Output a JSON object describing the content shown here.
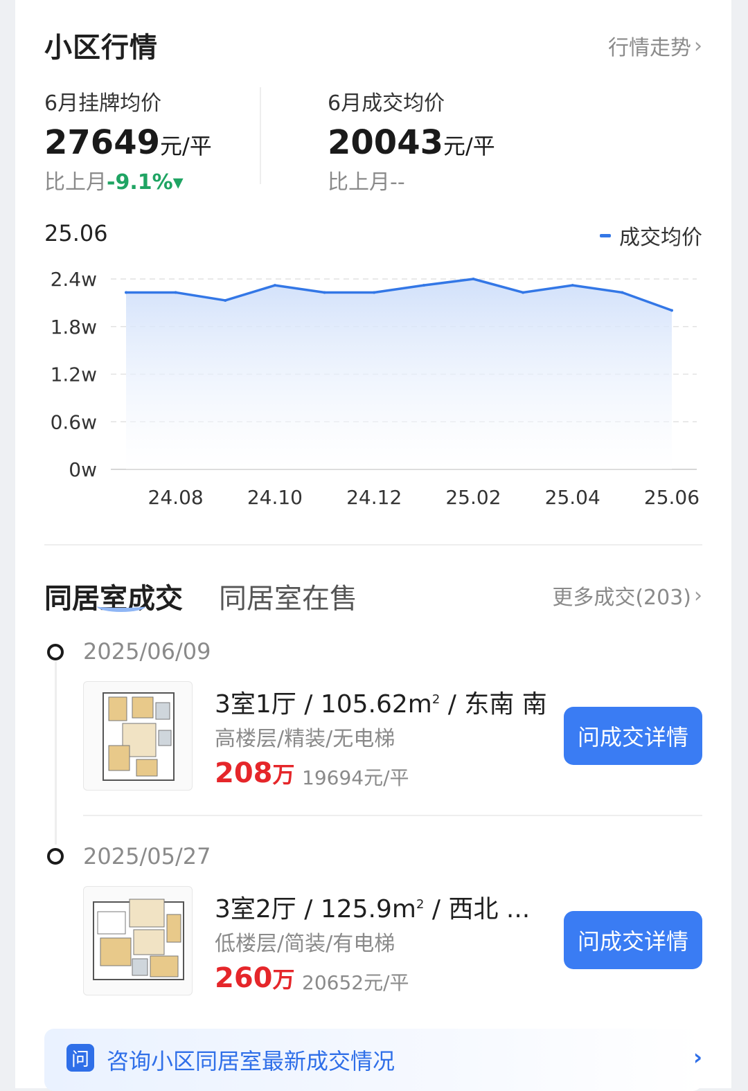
{
  "section": {
    "title": "小区行情",
    "trend_link": "行情走势"
  },
  "stats": {
    "listing": {
      "label": "6月挂牌均价",
      "value": "27649",
      "unit": "元/平",
      "compare_prefix": "比上月",
      "compare_value": "-9.1%▾"
    },
    "deal": {
      "label": "6月成交均价",
      "value": "20043",
      "unit": "元/平",
      "compare_prefix": "比上月",
      "compare_value": "--"
    }
  },
  "chart_header": {
    "month": "25.06",
    "legend": "成交均价"
  },
  "chart_data": {
    "type": "area",
    "x": [
      "24.07",
      "24.08",
      "24.09",
      "24.10",
      "24.11",
      "24.12",
      "25.01",
      "25.02",
      "25.03",
      "25.04",
      "25.05",
      "25.06"
    ],
    "series": [
      {
        "name": "成交均价",
        "values": [
          22300,
          22300,
          21300,
          23200,
          22300,
          22300,
          23200,
          24000,
          22300,
          23200,
          22300,
          20043
        ]
      }
    ],
    "x_tick_labels": [
      "24.08",
      "24.10",
      "24.12",
      "25.02",
      "25.04",
      "25.06"
    ],
    "y_tick_labels": [
      "0w",
      "0.6w",
      "1.2w",
      "1.8w",
      "2.4w"
    ],
    "ylim": [
      0,
      24000
    ],
    "grid": true,
    "legend_position": "top-right",
    "colors": {
      "line": "#3377e6",
      "fill": "#dbe7fb"
    }
  },
  "tabs": [
    {
      "label": "同居室成交",
      "active": true
    },
    {
      "label": "同居室在售",
      "active": false
    }
  ],
  "more_link": "更多成交(203)",
  "deals": [
    {
      "date": "2025/06/09",
      "title_pre": "3室1厅 / 105.62m",
      "title_sup": "2",
      "title_post": " / 东南 南",
      "sub": "高楼层/精装/无电梯",
      "price": "208",
      "price_unit": "万",
      "unit_price": "19694元/平",
      "button": "问成交详情"
    },
    {
      "date": "2025/05/27",
      "title_pre": "3室2厅 / 125.9m",
      "title_sup": "2",
      "title_post": " / 西北 ...",
      "sub": "低楼层/简装/有电梯",
      "price": "260",
      "price_unit": "万",
      "unit_price": "20652元/平",
      "button": "问成交详情"
    }
  ],
  "consult": {
    "badge": "问",
    "text": "咨询小区同居室最新成交情况"
  }
}
